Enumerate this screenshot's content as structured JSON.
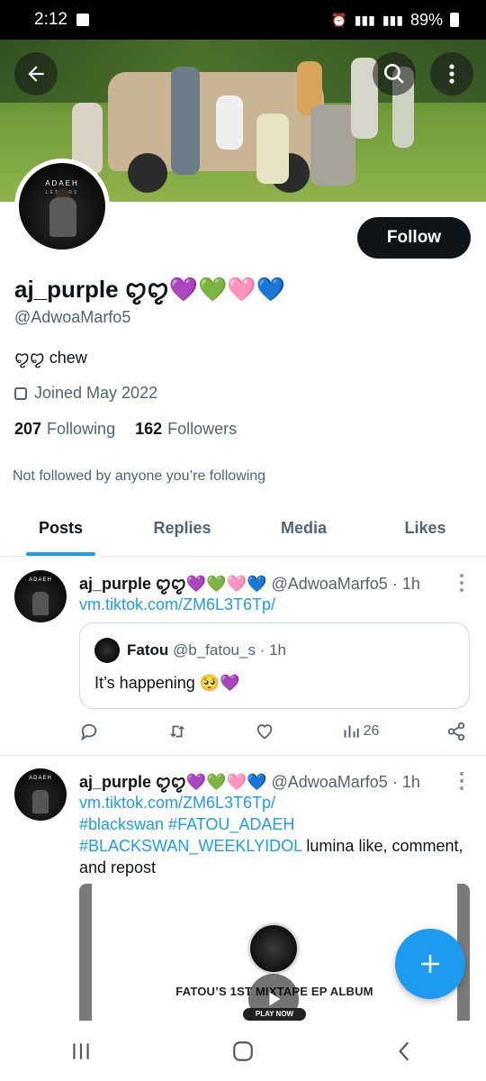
{
  "status_bar": {
    "time": "2:12",
    "battery": "89%"
  },
  "profile": {
    "display_name": "aj_purple ꨄ︎ꨄ︎💜💚🩷💙",
    "handle": "@AdwoaMarfo5",
    "bio": "ꨄ︎ꨄ︎ chew",
    "joined": "Joined May 2022",
    "following_count": "207",
    "following_label": "Following",
    "followers_count": "162",
    "followers_label": "Followers",
    "not_followed_note": "Not followed by anyone you’re following",
    "follow_button": "Follow",
    "avatar_text": "ADAEH",
    "avatar_subtext": "LETTERS"
  },
  "tabs": [
    {
      "label": "Posts",
      "active": true
    },
    {
      "label": "Replies",
      "active": false
    },
    {
      "label": "Media",
      "active": false
    },
    {
      "label": "Likes",
      "active": false
    }
  ],
  "tweets": [
    {
      "author": "aj_purple ꨄ︎ꨄ︎💜💚🩷💙",
      "handle": "@AdwoaMarfo5",
      "time": "· 1h",
      "link": "vm.tiktok.com/ZM6L3T6Tp/",
      "quote": {
        "author": "Fatou",
        "handle": "@b_fatou_s",
        "time": "· 1h",
        "text": "It’s happening 🥺💜"
      },
      "views": "26"
    },
    {
      "author": "aj_purple ꨄ︎ꨄ︎💜💚🩷💙",
      "handle": "@AdwoaMarfo5",
      "time": "· 1h",
      "link": "vm.tiktok.com/ZM6L3T6Tp/",
      "hashtags_line1": "#blackswan #FATOU_ADAEH",
      "hashtag2": "#BLACKSWAN_WEEKLYIDOL",
      "text_after": " lumina like, comment,",
      "text_line3": "and repost",
      "media_title": "FATOU’S 1ST MIXTAPE EP ALBUM",
      "media_button": "PLAY NOW"
    }
  ],
  "colors": {
    "accent": "#1d9bf0",
    "text": "#0f1419",
    "muted": "#536471"
  }
}
